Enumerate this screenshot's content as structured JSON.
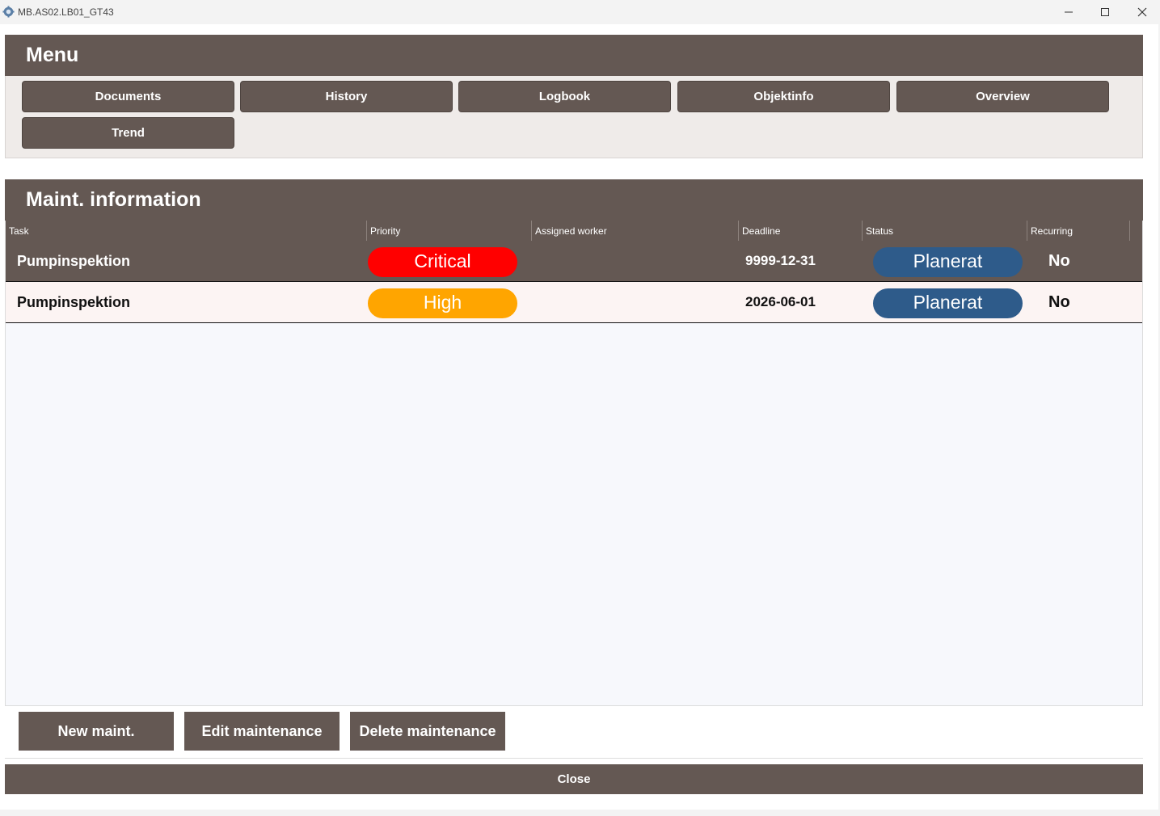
{
  "window": {
    "title": "MB.AS02.LB01_GT43"
  },
  "menu": {
    "title": "Menu",
    "buttons": [
      "Documents",
      "History",
      "Logbook",
      "Objektinfo",
      "Overview",
      "Trend"
    ]
  },
  "maint": {
    "title": "Maint. information",
    "columns": [
      "Task",
      "Priority",
      "Assigned worker",
      "Deadline",
      "Status",
      "Recurring"
    ],
    "rows": [
      {
        "task": "Pumpinspektion",
        "priority": "Critical",
        "priority_color": "#ff0000",
        "worker": "",
        "deadline": "9999-12-31",
        "status": "Planerat",
        "status_color": "#2e5b8a",
        "recurring": "No",
        "row_style": "selected"
      },
      {
        "task": "Pumpinspektion",
        "priority": "High",
        "priority_color": "#ffa500",
        "worker": "",
        "deadline": "2026-06-01",
        "status": "Planerat",
        "status_color": "#2e5b8a",
        "recurring": "No",
        "row_style": "normal"
      }
    ]
  },
  "actions": {
    "new": "New maint.",
    "edit": "Edit maintenance",
    "delete": "Delete maintenance"
  },
  "close_label": "Close",
  "colors": {
    "brand": "#645853",
    "menu_bg": "#efebe9",
    "grid_bg": "#f7f8fc",
    "row_alt": "#fcf4f3"
  },
  "icons": {
    "app": "gear-icon",
    "minimize": "minimize-icon",
    "maximize": "maximize-icon",
    "close": "close-icon"
  }
}
